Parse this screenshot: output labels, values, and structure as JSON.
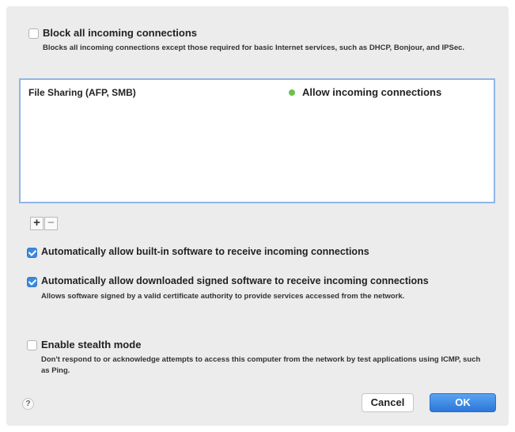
{
  "block_all": {
    "label": "Block all incoming connections",
    "description": "Blocks all incoming connections except those required for basic Internet services,  such as DHCP, Bonjour, and IPSec.",
    "checked": false
  },
  "services": [
    {
      "name": "File Sharing (AFP, SMB)",
      "status": "Allow incoming connections",
      "status_color": "#6cc24a"
    }
  ],
  "list_controls": {
    "add": "+",
    "remove": "−"
  },
  "auto_builtin": {
    "label": "Automatically allow built-in software to receive incoming connections",
    "checked": true
  },
  "auto_signed": {
    "label": "Automatically allow downloaded signed software to receive incoming connections",
    "description": "Allows software signed by a valid certificate authority to provide services accessed from the network.",
    "checked": true
  },
  "stealth": {
    "label": "Enable stealth mode",
    "description": "Don't respond to or acknowledge attempts to access this computer from the network by test applications using ICMP, such as Ping.",
    "checked": false
  },
  "footer": {
    "help": "?",
    "cancel": "Cancel",
    "ok": "OK"
  },
  "colors": {
    "accent": "#3b8ae0",
    "list_border": "#8fb6e6",
    "background": "#ececec"
  }
}
